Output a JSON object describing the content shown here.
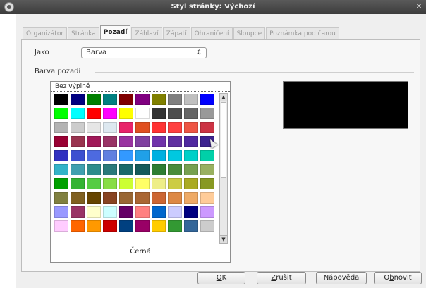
{
  "window": {
    "title": "Styl stránky: Výchozí"
  },
  "tabs": [
    {
      "label": "Organizátor",
      "active": false
    },
    {
      "label": "Stránka",
      "active": false
    },
    {
      "label": "Pozadí",
      "active": true
    },
    {
      "label": "Záhlaví",
      "active": false
    },
    {
      "label": "Zápatí",
      "active": false
    },
    {
      "label": "Ohraničení",
      "active": false
    },
    {
      "label": "Sloupce",
      "active": false
    },
    {
      "label": "Poznámka pod čarou",
      "active": false
    }
  ],
  "type_field": {
    "label": "Jako",
    "value": "Barva"
  },
  "background_section": {
    "title": "Barva pozadí"
  },
  "palette": {
    "no_fill_label": "Bez výplně",
    "selected_color_name": "Černá",
    "colors": [
      "#000000",
      "#000080",
      "#008000",
      "#008080",
      "#800000",
      "#800080",
      "#808000",
      "#808080",
      "#c0c0c0",
      "#0000ff",
      "#00ff00",
      "#00ffff",
      "#ff0000",
      "#ff00ff",
      "#ffff00",
      "#ffffff",
      "#333333",
      "#4d4d4d",
      "#666666",
      "#999999",
      "#b3b3b3",
      "#cccccc",
      "#e6e6e6",
      "#dde8f0",
      "#e8236a",
      "#e05020",
      "#ff3333",
      "#ff4040",
      "#ee5544",
      "#cc3344",
      "#990033",
      "#99334f",
      "#a01858",
      "#993366",
      "#9933a0",
      "#8040a0",
      "#7033aa",
      "#6030a0",
      "#5028a0",
      "#3d2290",
      "#3030c0",
      "#3c50d0",
      "#4d6ae0",
      "#6080e0",
      "#3399ff",
      "#20a0e8",
      "#00b0e0",
      "#00c8e0",
      "#00d0c8",
      "#00d0a8",
      "#33b3c8",
      "#40a0b0",
      "#2e8c8c",
      "#2a7a7a",
      "#1a6a6a",
      "#145a5a",
      "#2e7d32",
      "#4a8c3a",
      "#77a050",
      "#99b060",
      "#00a000",
      "#33b333",
      "#55cc44",
      "#88dd44",
      "#ccff33",
      "#ffff66",
      "#eeee88",
      "#cccc44",
      "#aaaa22",
      "#889922",
      "#808040",
      "#806020",
      "#664400",
      "#884422",
      "#996633",
      "#aa6633",
      "#cc6633",
      "#dd8844",
      "#eeaa66",
      "#ffcc99",
      "#9999ff",
      "#993366",
      "#ffffcc",
      "#ccffff",
      "#660066",
      "#ff8080",
      "#0066cc",
      "#ccccff",
      "#000080",
      "#cc99ff",
      "#ffccff",
      "#ff6600",
      "#ff9900",
      "#cc0000",
      "#004080",
      "#990066",
      "#ffcc00",
      "#339933",
      "#336699",
      "#cccccc"
    ]
  },
  "preview": {
    "color": "#000000"
  },
  "buttons": {
    "ok": {
      "mnemonic": "O",
      "rest": "K"
    },
    "reset": {
      "mnemonic": "Z",
      "rest": "rušit"
    },
    "help": {
      "label": "Nápověda"
    },
    "restore": {
      "prefix": "O",
      "mnemonic": "b",
      "rest": "novit"
    }
  }
}
